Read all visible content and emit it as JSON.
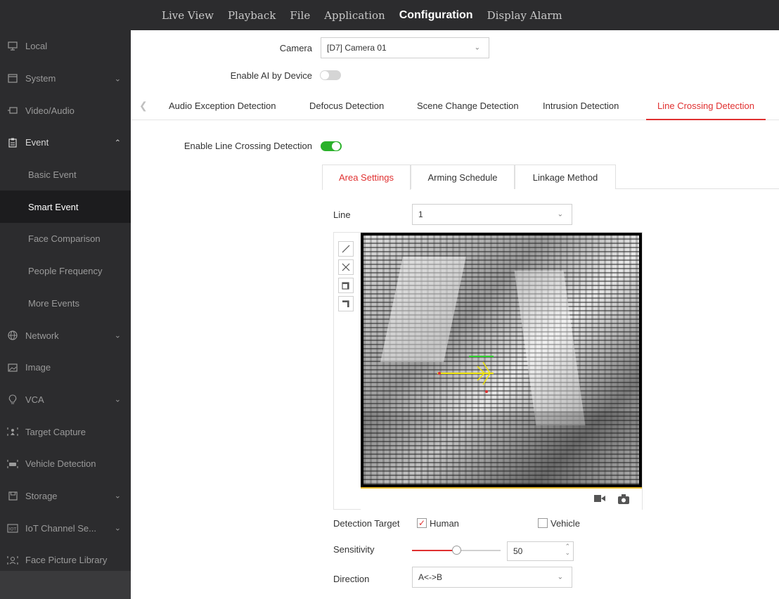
{
  "top_nav": {
    "items": [
      {
        "label": "Live View",
        "active": false
      },
      {
        "label": "Playback",
        "active": false
      },
      {
        "label": "File",
        "active": false
      },
      {
        "label": "Application",
        "active": false
      },
      {
        "label": "Configuration",
        "active": true
      },
      {
        "label": "Display Alarm",
        "active": false
      }
    ]
  },
  "sidebar": {
    "items": [
      {
        "label": "Local",
        "icon": "monitor-icon"
      },
      {
        "label": "System",
        "icon": "window-icon",
        "chevron": "down"
      },
      {
        "label": "Video/Audio",
        "icon": "video-icon"
      },
      {
        "label": "Event",
        "icon": "clipboard-icon",
        "chevron": "up"
      },
      {
        "label": "Basic Event",
        "sub": true
      },
      {
        "label": "Smart Event",
        "sub": true,
        "active": true
      },
      {
        "label": "Face Comparison",
        "sub": true
      },
      {
        "label": "People Frequency",
        "sub": true
      },
      {
        "label": "More Events",
        "sub": true
      },
      {
        "label": "Network",
        "icon": "globe-icon",
        "chevron": "down"
      },
      {
        "label": "Image",
        "icon": "image-icon"
      },
      {
        "label": "VCA",
        "icon": "bulb-icon",
        "chevron": "down"
      },
      {
        "label": "Target Capture",
        "icon": "target-icon"
      },
      {
        "label": "Vehicle Detection",
        "icon": "car-icon"
      },
      {
        "label": "Storage",
        "icon": "floppy-icon",
        "chevron": "down"
      },
      {
        "label": "IoT Channel Se...",
        "icon": "iot-icon",
        "chevron": "down"
      },
      {
        "label": "Face Picture Library",
        "icon": "face-icon"
      }
    ]
  },
  "camera": {
    "label": "Camera",
    "value": "[D7] Camera 01"
  },
  "enable_ai": {
    "label": "Enable AI by Device",
    "enabled": false
  },
  "detection_tabs": [
    {
      "label": "Audio Exception Detection"
    },
    {
      "label": "Defocus Detection"
    },
    {
      "label": "Scene Change Detection"
    },
    {
      "label": "Intrusion Detection"
    },
    {
      "label": "Line Crossing Detection",
      "active": true
    }
  ],
  "enable_lcd": {
    "label": "Enable Line Crossing Detection",
    "enabled": true
  },
  "inner_tabs": [
    {
      "label": "Area Settings",
      "active": true
    },
    {
      "label": "Arming Schedule"
    },
    {
      "label": "Linkage Method"
    }
  ],
  "line": {
    "label": "Line",
    "value": "1"
  },
  "tools": [
    "draw-line-icon",
    "clear-icon",
    "region-icon-1",
    "region-icon-2"
  ],
  "detection_target": {
    "label": "Detection Target",
    "options": [
      {
        "label": "Human",
        "checked": true
      },
      {
        "label": "Vehicle",
        "checked": false
      }
    ]
  },
  "sensitivity": {
    "label": "Sensitivity",
    "value": "50",
    "level": 0.5
  },
  "direction": {
    "label": "Direction",
    "value": "A<->B"
  },
  "colors": {
    "accent": "#e03030",
    "toggle_on": "#2ab12a",
    "sidebar_bg": "#2c2c2e"
  }
}
